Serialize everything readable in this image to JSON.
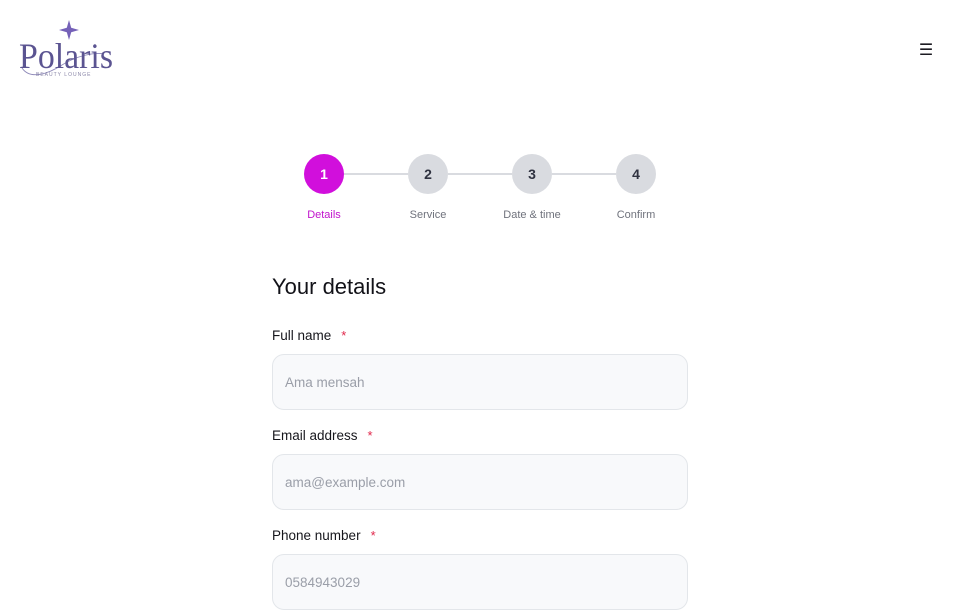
{
  "brand": {
    "name": "Polaris",
    "tagline": "BEAUTY LOUNGE",
    "color": "#5b5491",
    "sparkle_color": "#7561b8"
  },
  "header": {
    "menu_icon": "☰"
  },
  "steps": [
    {
      "number": "1",
      "label": "Details",
      "active": true
    },
    {
      "number": "2",
      "label": "Service",
      "active": false
    },
    {
      "number": "3",
      "label": "Date & time",
      "active": false
    },
    {
      "number": "4",
      "label": "Confirm",
      "active": false
    }
  ],
  "colors": {
    "accent": "#d10fdc",
    "inactive_step": "#d9dbe0",
    "required": "#e0264a"
  },
  "form": {
    "title": "Your details",
    "fields": [
      {
        "label": "Full name",
        "required_mark": "*",
        "placeholder": "Ama mensah",
        "value": ""
      },
      {
        "label": "Email address",
        "required_mark": "*",
        "placeholder": "ama@example.com",
        "value": ""
      },
      {
        "label": "Phone number",
        "required_mark": "*",
        "placeholder": "0584943029",
        "value": ""
      }
    ]
  }
}
